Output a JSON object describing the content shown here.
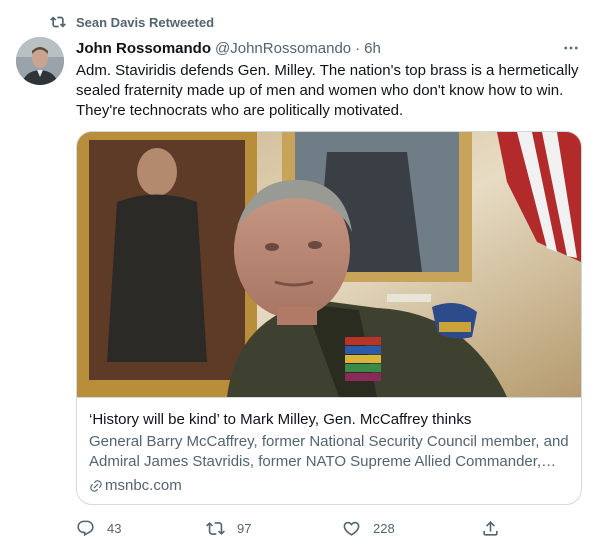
{
  "retweet": {
    "icon": "retweet-icon",
    "text": "Sean Davis Retweeted"
  },
  "tweet": {
    "avatar_icon": "user-avatar",
    "author_name": "John Rossomando",
    "handle": "@JohnRossomando",
    "separator": "·",
    "time": "6h",
    "more_icon": "more-icon",
    "text": "Adm. Staviridis defends Gen. Milley. The nation's top brass is a hermetically sealed fraternity made up of men and women who don't know how to win. They're technocrats who are politically motivated."
  },
  "card": {
    "image_icon": "article-photo",
    "title": "‘History will be kind’ to Mark Milley, Gen. McCaffrey thinks",
    "description": "General Barry McCaffrey, former National Security Council member, and Admiral James Stavridis, former NATO Supreme Allied Commander, la...",
    "domain": "msnbc.com",
    "link_icon": "link-icon"
  },
  "actions": {
    "reply": {
      "icon": "reply-icon",
      "count": "43"
    },
    "retweet": {
      "icon": "retweet-icon",
      "count": "97"
    },
    "like": {
      "icon": "heart-icon",
      "count": "228"
    },
    "share": {
      "icon": "share-icon"
    }
  },
  "colors": {
    "text_primary": "#0f1419",
    "text_secondary": "#536471",
    "border": "#cfd9de",
    "background": "#ffffff"
  }
}
